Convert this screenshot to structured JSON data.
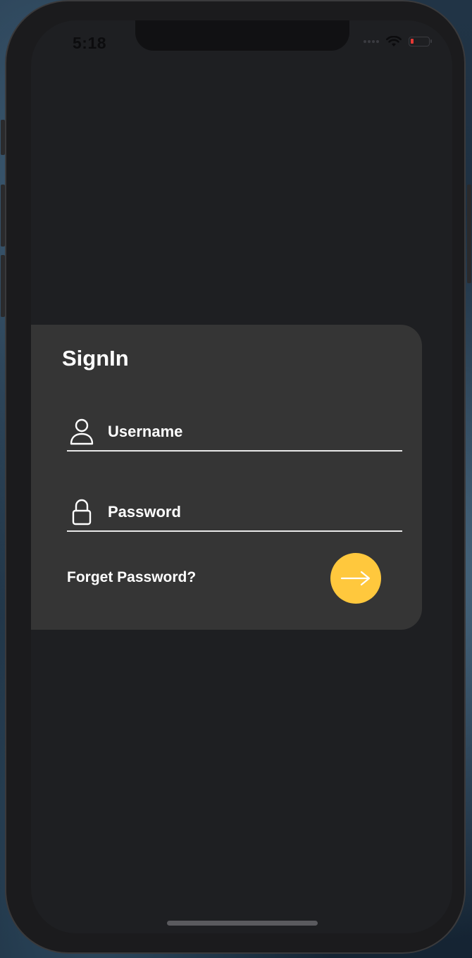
{
  "status_bar": {
    "time": "5:18",
    "battery_color": "#e53935"
  },
  "signin_card": {
    "title": "SignIn",
    "username": {
      "placeholder": "Username",
      "value": "",
      "icon": "person-icon"
    },
    "password": {
      "placeholder": "Password",
      "value": "",
      "icon": "lock-icon"
    },
    "forget_password_label": "Forget Password?",
    "submit": {
      "icon": "arrow-right-icon",
      "color": "#ffc83d"
    }
  },
  "colors": {
    "screen_background": "#1e1f22",
    "card_background": "#353535",
    "accent": "#ffc83d",
    "text": "#ffffff"
  }
}
